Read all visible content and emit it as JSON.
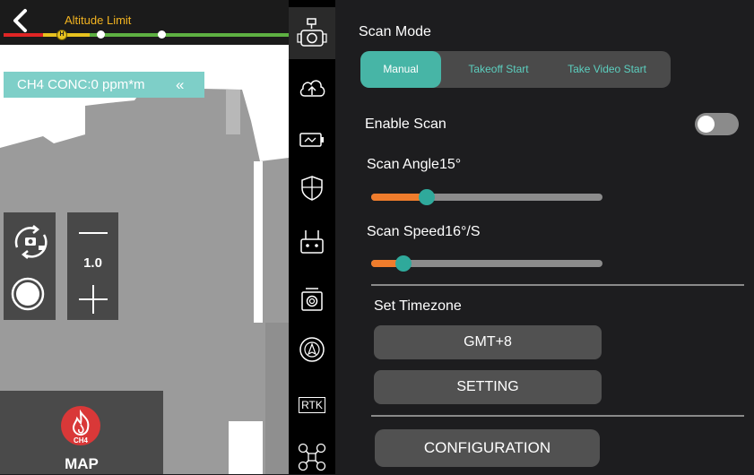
{
  "colors": {
    "accent_teal": "#47b5a6",
    "slider_orange": "#ef7c2c",
    "altitude_label": "#f2b320",
    "ch4_banner": "#7ecfc8",
    "map_icon_red": "#d93838"
  },
  "camera": {
    "altitude_label": "Altitude Limit",
    "altitude_marker": "H",
    "ch4_conc": "CH4 CONC:0 ppm*m",
    "ch4_collapse": "«",
    "zoom_value": "1.0",
    "map_badge": "CH4",
    "map_label": "MAP"
  },
  "rail": {
    "icons": [
      "gimbal-camera-icon",
      "cloud-upload-icon",
      "battery-icon",
      "shield-icon",
      "remote-controller-icon",
      "camera-settings-icon",
      "navigation-icon",
      "rtk-icon",
      "drone-icon"
    ],
    "rtk_label": "RTK"
  },
  "settings": {
    "scan_mode_label": "Scan Mode",
    "modes": [
      "Manual",
      "Takeoff Start",
      "Take Video Start"
    ],
    "selected_mode": "Manual",
    "enable_scan_label": "Enable Scan",
    "enable_scan_on": false,
    "scan_angle_label": "Scan Angle15°",
    "scan_angle_fraction": 0.24,
    "scan_speed_label": "Scan Speed16°/S",
    "scan_speed_fraction": 0.14,
    "timezone_label": "Set Timezone",
    "timezone_value": "GMT+8",
    "setting_button": "SETTING",
    "configuration_button": "CONFIGURATION"
  }
}
